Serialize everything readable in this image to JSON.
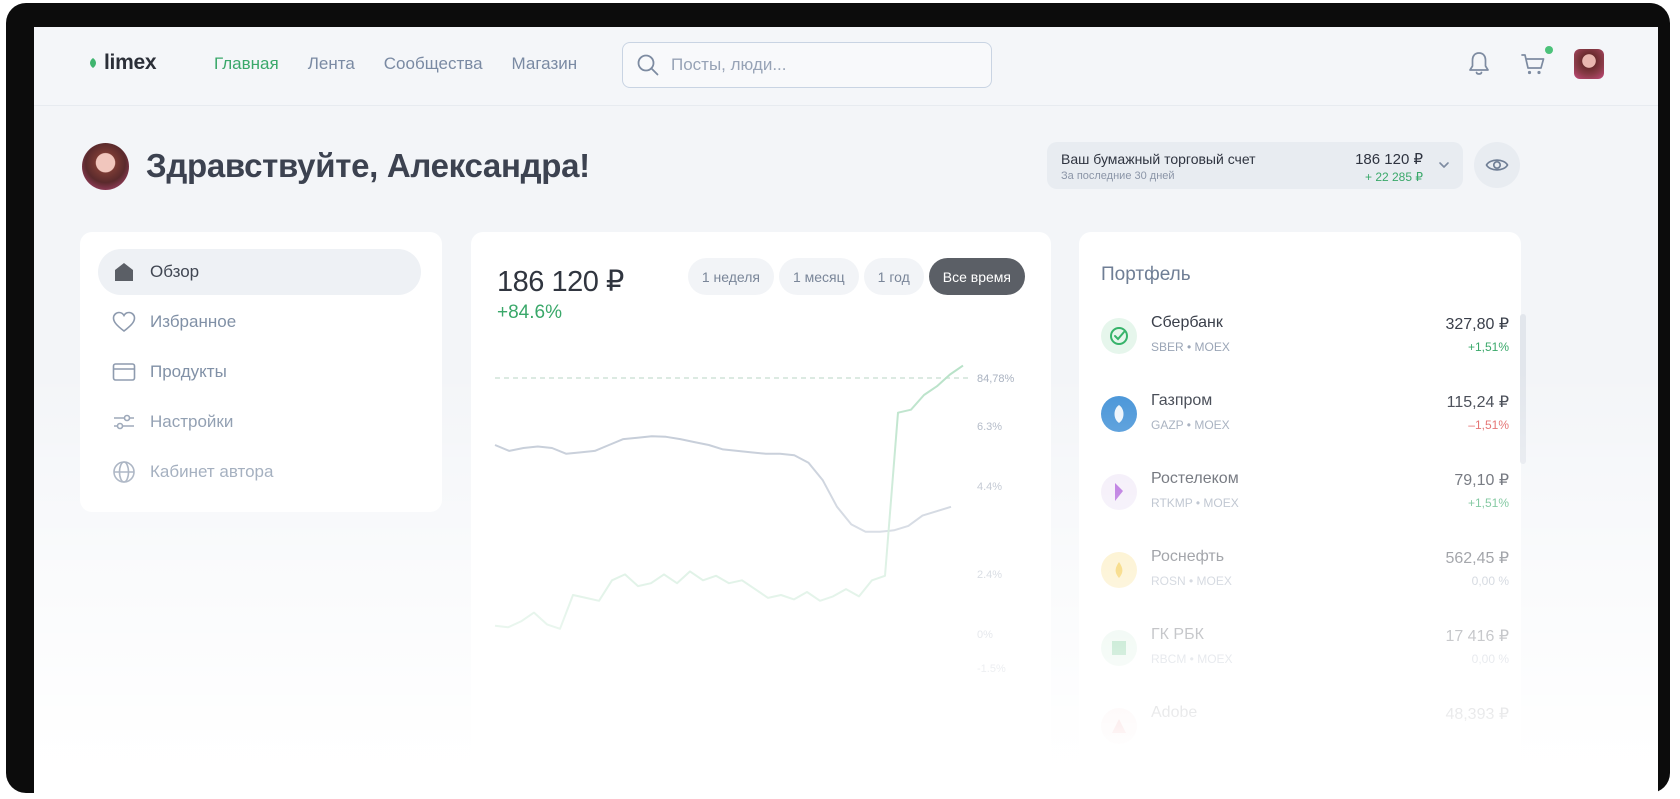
{
  "header": {
    "logo": "limex",
    "nav": [
      {
        "label": "Главная",
        "active": true
      },
      {
        "label": "Лента",
        "active": false
      },
      {
        "label": "Сообщества",
        "active": false
      },
      {
        "label": "Магазин",
        "active": false
      }
    ],
    "search_placeholder": "Посты, люди..."
  },
  "greeting": "Здравствуйте, Александра!",
  "account": {
    "title": "Ваш бумажный торговый счет",
    "subtitle": "За последние 30 дней",
    "balance": "186 120 ₽",
    "delta": "+ 22 285 ₽"
  },
  "menu": [
    {
      "label": "Обзор",
      "icon": "home-icon",
      "active": true
    },
    {
      "label": "Избранное",
      "icon": "heart-icon",
      "active": false
    },
    {
      "label": "Продукты",
      "icon": "card-icon",
      "active": false
    },
    {
      "label": "Настройки",
      "icon": "sliders-icon",
      "active": false
    },
    {
      "label": "Кабинет автора",
      "icon": "globe-icon",
      "active": false
    }
  ],
  "main": {
    "balance": "186 120 ₽",
    "change": "+84.6%",
    "periods": [
      {
        "label": "1 неделя",
        "active": false
      },
      {
        "label": "1 месяц",
        "active": false
      },
      {
        "label": "1 год",
        "active": false
      },
      {
        "label": "Все время",
        "active": true
      }
    ]
  },
  "chart_data": {
    "type": "line",
    "y_tick_labels": [
      "84,78%",
      "6.3%",
      "4.4%",
      "2.4%",
      "0%",
      "-1.5%"
    ],
    "reference_line_label": "84,78%",
    "series": [
      {
        "color": "#b9c2d0",
        "values": [
          6.2,
          6.0,
          6.1,
          6.15,
          6.1,
          5.9,
          5.95,
          6.0,
          6.2,
          6.4,
          6.45,
          6.5,
          6.48,
          6.4,
          6.3,
          6.2,
          6.05,
          6.0,
          5.95,
          5.9,
          5.9,
          5.85,
          5.6,
          5.0,
          4.1,
          3.5,
          3.25,
          3.25,
          3.3,
          3.45,
          3.8,
          3.95,
          4.1
        ]
      },
      {
        "color": "#b8e2c8",
        "values": [
          0.05,
          0.0,
          0.2,
          0.5,
          0.1,
          -0.05,
          1.1,
          1.0,
          0.9,
          1.6,
          1.8,
          1.4,
          1.5,
          1.8,
          1.5,
          1.9,
          1.6,
          1.75,
          1.5,
          1.6,
          1.3,
          1.0,
          1.1,
          0.95,
          1.2,
          0.9,
          1.05,
          1.3,
          1.05,
          1.6,
          1.75,
          7.3,
          7.4,
          7.9,
          8.2,
          8.6,
          8.9
        ]
      }
    ]
  },
  "portfolio": {
    "title": "Портфель",
    "items": [
      {
        "name": "Сбербанк",
        "ticker": "SBER • MOEX",
        "price": "327,80 ₽",
        "change": "+1,51%",
        "trend": "up",
        "logo_color": "#e6f6ec",
        "icon": "sber-logo-icon"
      },
      {
        "name": "Газпром",
        "ticker": "GAZP • MOEX",
        "price": "115,24 ₽",
        "change": "–1,51%",
        "trend": "down",
        "logo_color": "#3e8fd6",
        "icon": "gazprom-logo-icon"
      },
      {
        "name": "Ростелеком",
        "ticker": "RTKMP • MOEX",
        "price": "79,10 ₽",
        "change": "+1,51%",
        "trend": "up",
        "logo_color": "#f1eaf8",
        "icon": "rostelecom-logo-icon"
      },
      {
        "name": "Роснефть",
        "ticker": "ROSN • MOEX",
        "price": "562,45 ₽",
        "change": "0,00 %",
        "trend": "flat",
        "logo_color": "#fbe7a8",
        "icon": "rosneft-logo-icon"
      },
      {
        "name": "ГК РБК",
        "ticker": "RBCM • MOEX",
        "price": "17 416 ₽",
        "change": "0,00 %",
        "trend": "flat",
        "logo_color": "#d6efdf",
        "icon": "rbc-logo-icon"
      },
      {
        "name": "Adobe",
        "ticker": "",
        "price": "48,393 ₽",
        "change": "",
        "trend": "flat",
        "logo_color": "#f6d7d7",
        "icon": "adobe-logo-icon"
      }
    ]
  }
}
